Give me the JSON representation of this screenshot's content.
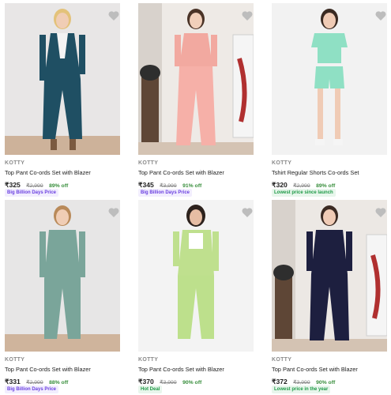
{
  "colors": {
    "discount_green": "#388e3c",
    "badge_purple_text": "#6a3fe0",
    "badge_green_text": "#1f9a47",
    "wishlist_heart": "#bdbdbd"
  },
  "products": [
    {
      "brand": "KOTTY",
      "title": "Top Pant Co-ords Set with Blazer",
      "price": "₹325",
      "mrp": "₹2,999",
      "discount": "89% off",
      "badge": "Big Billion Days Price",
      "badge_style": "purple",
      "icon": "heart-icon"
    },
    {
      "brand": "KOTTY",
      "title": "Top Pant Co-ords Set with Blazer",
      "price": "₹345",
      "mrp": "₹3,999",
      "discount": "91% off",
      "badge": "Big Billion Days Price",
      "badge_style": "purple",
      "icon": "heart-icon"
    },
    {
      "brand": "KOTTY",
      "title": "Tshirt Regular Shorts Co-ords Set",
      "price": "₹320",
      "mrp": "₹2,999",
      "discount": "89% off",
      "badge": "Lowest price since launch",
      "badge_style": "green",
      "icon": "heart-icon"
    },
    {
      "brand": "KOTTY",
      "title": "Top Pant Co-ords Set with Blazer",
      "price": "₹331",
      "mrp": "₹2,999",
      "discount": "88% off",
      "badge": "Big Billion Days Price",
      "badge_style": "purple",
      "icon": "heart-icon"
    },
    {
      "brand": "KOTTY",
      "title": "Top Pant Co-ords Set with Blazer",
      "price": "₹370",
      "mrp": "₹3,999",
      "discount": "90% off",
      "badge": "Hot Deal",
      "badge_style": "green",
      "icon": "heart-icon"
    },
    {
      "brand": "KOTTY",
      "title": "Top Pant Co-ords Set with Blazer",
      "price": "₹372",
      "mrp": "₹3,999",
      "discount": "90% off",
      "badge": "Lowest price in the year",
      "badge_style": "green",
      "icon": "heart-icon"
    }
  ]
}
